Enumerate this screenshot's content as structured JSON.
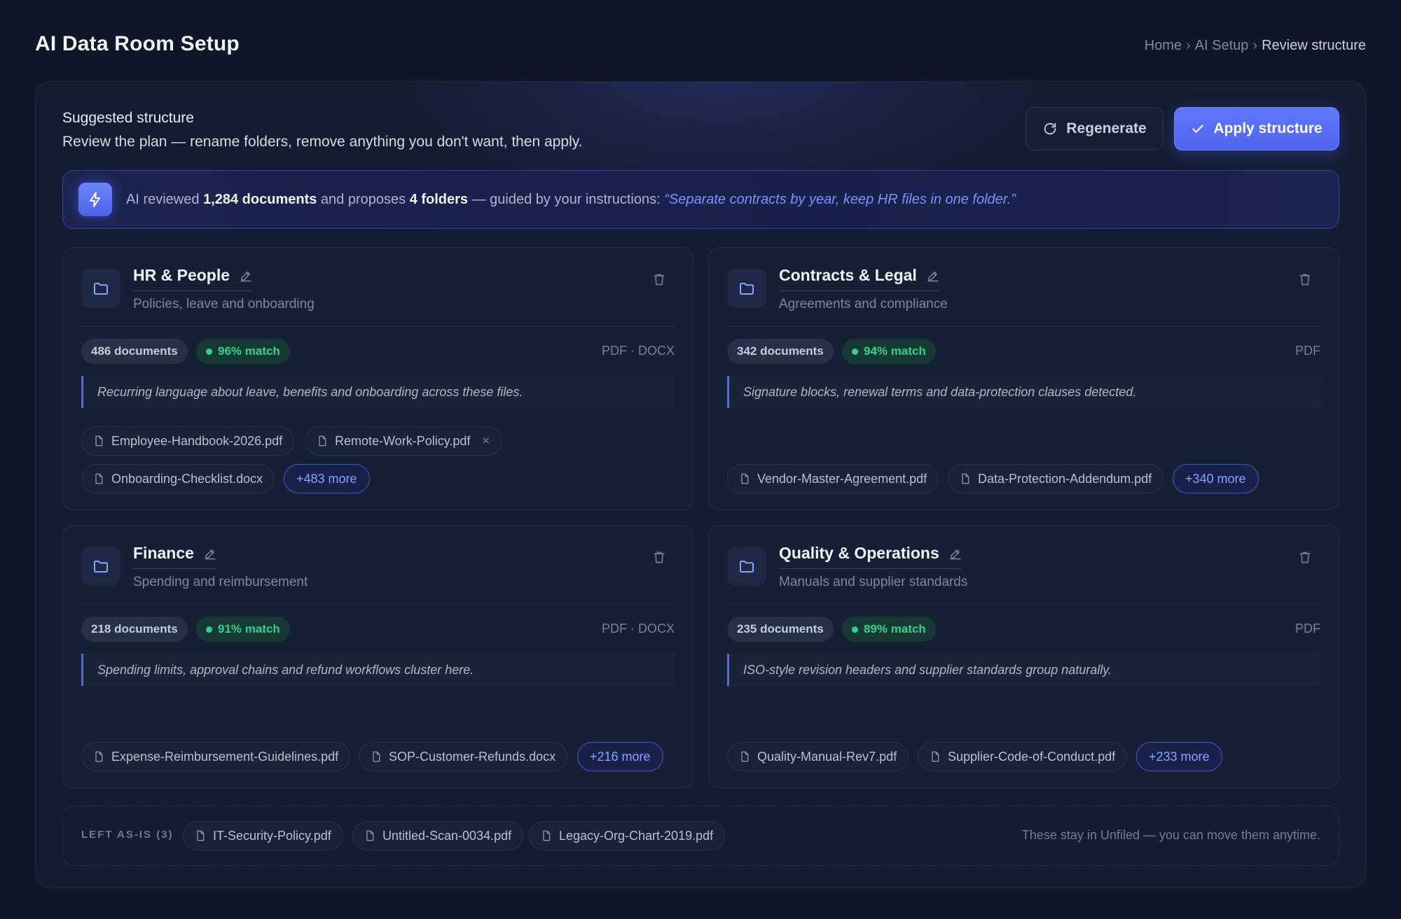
{
  "header": {
    "title": "AI Data Room Setup",
    "breadcrumb": [
      "Home",
      "AI Setup",
      "Review structure"
    ],
    "breadcrumb_sep": "›"
  },
  "panel": {
    "heading": "Suggested structure",
    "subheading": "Review the plan — rename folders, remove anything you don't want, then apply.",
    "regenerate_label": "Regenerate",
    "apply_label": "Apply structure"
  },
  "ai_banner": {
    "prefix": "AI reviewed",
    "doc_count": "1,284 documents",
    "middle": "and proposes",
    "folder_count": "4 folders",
    "guided": "— guided by your instructions:",
    "instruction": "“Separate contracts by year, keep HR files in one folder.”"
  },
  "folders": [
    {
      "name": "HR & People",
      "description": "Policies, leave and onboarding",
      "count": "486 documents",
      "match": "96% match",
      "types": "PDF · DOCX",
      "note": "Recurring language about leave, benefits and onboarding across these files.",
      "files": [
        "Employee-Handbook-2026.pdf",
        "Remote-Work-Policy.pdf",
        "Onboarding-Checklist.docx"
      ],
      "more": "+483 more"
    },
    {
      "name": "Contracts & Legal",
      "description": "Agreements and compliance",
      "count": "342 documents",
      "match": "94% match",
      "types": "PDF",
      "note": "Signature blocks, renewal terms and data-protection clauses detected.",
      "files": [
        "Vendor-Master-Agreement.pdf",
        "Data-Protection-Addendum.pdf"
      ],
      "more": "+340 more"
    },
    {
      "name": "Finance",
      "description": "Spending and reimbursement",
      "count": "218 documents",
      "match": "91% match",
      "types": "PDF · DOCX",
      "note": "Spending limits, approval chains and refund workflows cluster here.",
      "files": [
        "Expense-Reimbursement-Guidelines.pdf",
        "SOP-Customer-Refunds.docx"
      ],
      "more": "+216 more"
    },
    {
      "name": "Quality & Operations",
      "description": "Manuals and supplier standards",
      "count": "235 documents",
      "match": "89% match",
      "types": "PDF",
      "note": "ISO-style revision headers and supplier standards group naturally.",
      "files": [
        "Quality-Manual-Rev7.pdf",
        "Supplier-Code-of-Conduct.pdf"
      ],
      "more": "+233 more"
    }
  ],
  "unfiled": {
    "label": "LEFT AS-IS (3)",
    "files": [
      "IT-Security-Policy.pdf",
      "Untitled-Scan-0034.pdf",
      "Legacy-Org-Chart-2019.pdf"
    ],
    "hint": "These stay in Unfiled — you can move them anytime."
  },
  "colors": {
    "background": "#0f1729",
    "accent": "#5f78ff",
    "match_green": "#2ed193"
  }
}
